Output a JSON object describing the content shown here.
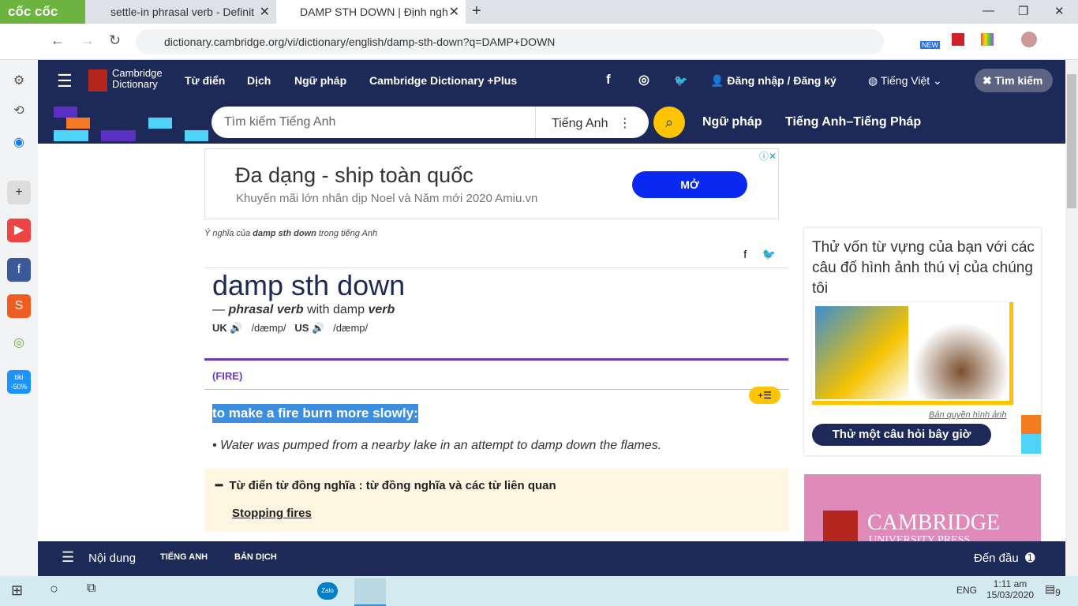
{
  "browser": {
    "brand": "cốc cốc",
    "tabs": [
      {
        "title": "settle-in phrasal verb - Definit"
      },
      {
        "title": "DAMP STH DOWN | Định ngh"
      }
    ],
    "url": "dictionary.cambridge.org/vi/dictionary/english/damp-sth-down?q=DAMP+DOWN",
    "ext_badge": "NEW"
  },
  "header": {
    "logo": "Cambridge Dictionary",
    "nav": [
      "Từ điển",
      "Dịch",
      "Ngữ pháp",
      "Cambridge Dictionary +Plus"
    ],
    "login": "Đăng nhập / Đăng ký",
    "language": "Tiếng Việt",
    "search_toggle": "Tìm kiếm"
  },
  "subheader": {
    "search_placeholder": "Tìm kiếm Tiếng Anh",
    "dictionary": "Tiếng Anh",
    "links": [
      "Ngữ pháp",
      "Tiếng Anh–Tiếng Pháp"
    ]
  },
  "ad": {
    "title": "Đa dạng - ship toàn quốc",
    "subtitle": "Khuyến mãi lớn nhân dịp Noel và Năm mới 2020 Amiu.vn",
    "button": "MỞ"
  },
  "entry": {
    "meaning_prefix": "Ý nghĩa của",
    "meaning_word": "damp sth down",
    "meaning_suffix": "trong tiếng Anh",
    "headword": "damp sth down",
    "pos": "phrasal verb",
    "with": "with damp",
    "pos2": "verb",
    "uk": "UK",
    "us": "US",
    "ipa_uk": "/dæmp/",
    "ipa_us": "/dæmp/",
    "guideword": "(FIRE)",
    "definition": "to make a fire burn more slowly:",
    "example": "Water was pumped from a nearby lake in an attempt to damp down the flames.",
    "thesaurus_title": "Từ điển từ đồng nghĩa : từ đồng nghĩa và các từ liên quan",
    "thesaurus_link": "Stopping fires"
  },
  "quiz": {
    "title": "Thử vốn từ vựng của bạn với các câu đố hình ảnh thú vị của chúng tôi",
    "credit": "Bản quyền hình ảnh",
    "button": "Thử một câu hỏi bây giờ"
  },
  "cup": {
    "text": "CAMBRIDGE",
    "sub": "UNIVERSITY PRESS"
  },
  "bottombar": {
    "menu": "Nội dung",
    "tabs": [
      "TIẾNG ANH",
      "BẢN DỊCH"
    ],
    "top": "Đến đầu"
  },
  "taskbar": {
    "lang": "ENG",
    "time": "1:11 am",
    "date": "15/03/2020",
    "notifications": "9",
    "zalo": "Zalo"
  }
}
